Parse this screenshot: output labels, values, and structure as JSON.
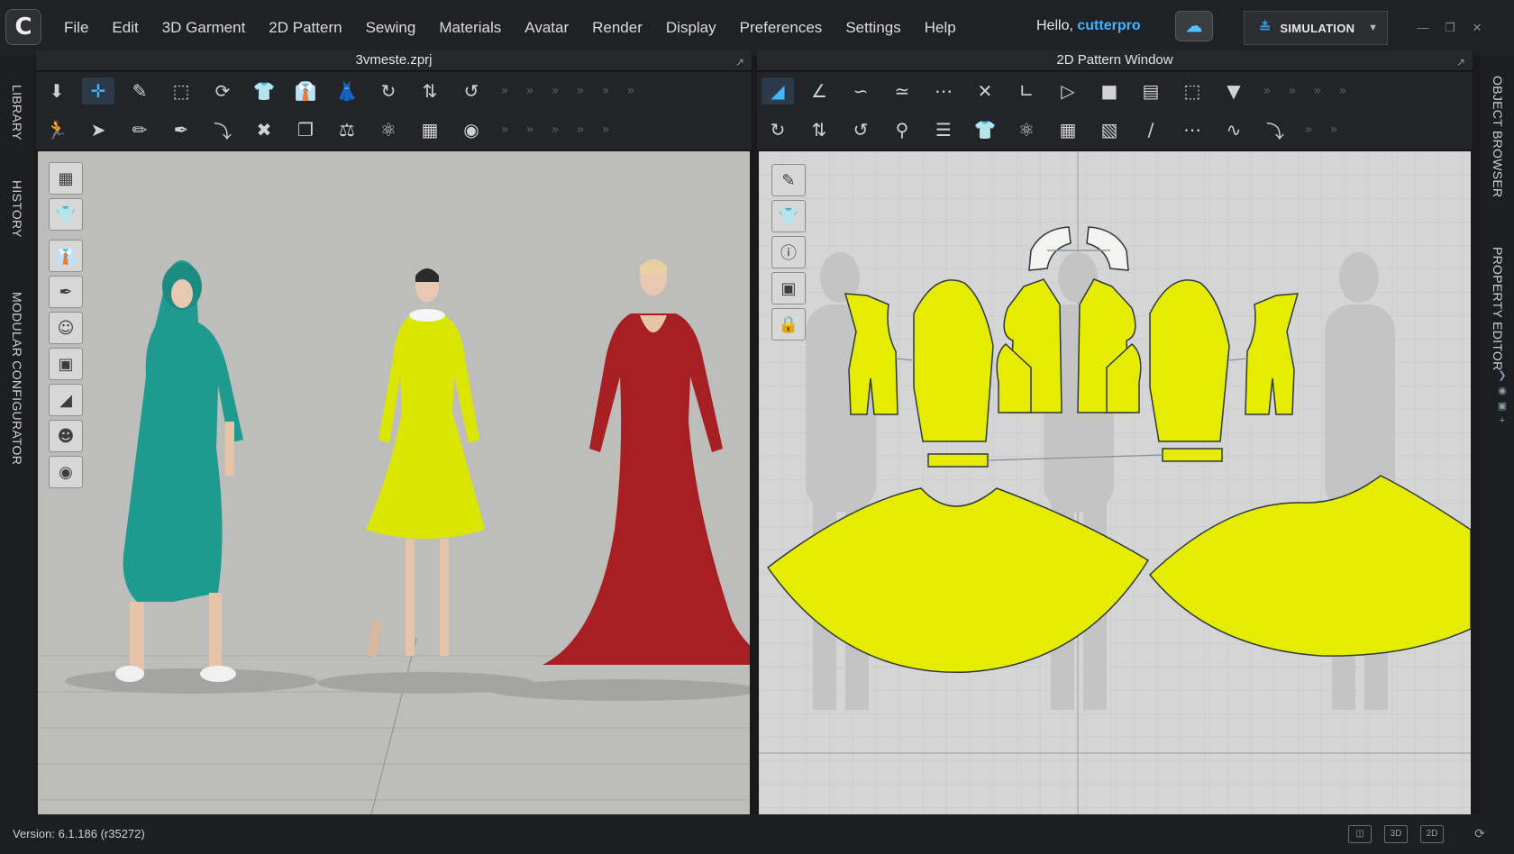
{
  "menu": [
    "File",
    "Edit",
    "3D Garment",
    "2D Pattern",
    "Sewing",
    "Materials",
    "Avatar",
    "Render",
    "Display",
    "Preferences",
    "Settings",
    "Help"
  ],
  "user": {
    "greeting": "Hello,",
    "name": "cutterpro"
  },
  "simulation": {
    "label": "SIMULATION"
  },
  "left_tabs": [
    "LIBRARY",
    "HISTORY",
    "MODULAR CONFIGURATOR"
  ],
  "right_tabs": [
    "OBJECT BROWSER",
    "PROPERTY EDITOR"
  ],
  "panel3d": {
    "title": "3vmeste.zprj"
  },
  "panel2d": {
    "title": "2D Pattern Window"
  },
  "status": {
    "version": "Version: 6.1.186 (r35272)",
    "view_3d": "3D",
    "view_2d": "2D"
  },
  "colors": {
    "accent": "#3fb6ff",
    "pattern_fill": "#e6ec00",
    "teal_dress": "#1f9a8f",
    "yellow_dress": "#dbe600",
    "red_dress": "#a71f22"
  },
  "icons": {
    "toolbar3d_row1": [
      "select-move-icon",
      "transform-icon",
      "edit-pattern-icon",
      "bounding-box-icon",
      "rotate-icon",
      "garment-a-icon",
      "garment-b-icon",
      "garment-c-icon",
      "sewing-a-icon",
      "sewing-b-icon",
      "sewing-c-icon"
    ],
    "toolbar3d_row2": [
      "avatar-walk-icon",
      "pin-icon",
      "brush-icon",
      "needle-icon",
      "tack-icon",
      "fold-icon",
      "layer-icon",
      "measure-icon",
      "fit-a-icon",
      "fit-b-icon",
      "button-icon"
    ],
    "toolbar2d_row1": [
      "edit-pattern-icon",
      "edit-point-icon",
      "curve-point-icon",
      "edit-curve-icon",
      "add-point-icon",
      "cut-icon",
      "offset-icon",
      "polygon-icon",
      "rectangle-icon",
      "circle-icon",
      "internal-shape-icon",
      "trace-icon"
    ],
    "toolbar2d_row2": [
      "segment-sew-icon",
      "free-sew-icon",
      "multi-sew-icon",
      "check-sew-icon",
      "iron-icon",
      "garment-icon",
      "fold-icon",
      "fit-icon",
      "fabric-icon",
      "topstitch-icon",
      "dash-line-icon",
      "wave-line-icon",
      "zip-icon"
    ]
  }
}
